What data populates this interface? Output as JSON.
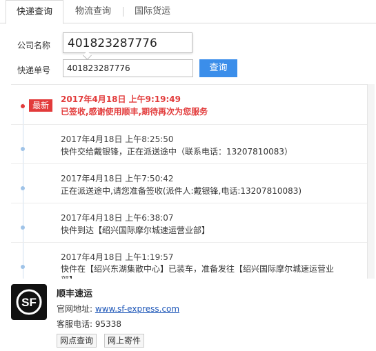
{
  "tabs": [
    {
      "label": "快递查询"
    },
    {
      "label": "物流查询"
    },
    {
      "label": "国际货运"
    }
  ],
  "form": {
    "company_label": "公司名称",
    "number_label": "快递单号",
    "company_value": "",
    "number_value": "401823287776",
    "hint_value": "401823287776",
    "query_button": "查询"
  },
  "result": {
    "latest_badge": "最新",
    "events": [
      {
        "time": "2017年4月18日 上午9:19:49",
        "desc": "已签收,感谢使用顺丰,期待再次为您服务"
      },
      {
        "time": "2017年4月18日 上午8:25:50",
        "desc": "快件交给戴银锋，正在派送途中（联系电话：13207810083）"
      },
      {
        "time": "2017年4月18日 上午7:50:42",
        "desc": "正在派送途中,请您准备签收(派件人:戴银锋,电话:13207810083)"
      },
      {
        "time": "2017年4月18日 上午6:38:07",
        "desc": "快件到达【绍兴国际摩尔城速运营业部】"
      },
      {
        "time": "2017年4月18日 上午1:19:57",
        "desc": "快件在【绍兴东湖集散中心】已装车，准备发往【绍兴国际摩尔城速运营业部】"
      }
    ]
  },
  "company": {
    "name": "顺丰速运",
    "site_label": "官网地址:",
    "site_url": "www.sf-express.com",
    "phone_label": "客服电话:",
    "phone": "95338",
    "btn_outlets": "网点查询",
    "btn_send": "网上寄件",
    "logo_text": "SF"
  },
  "colors": {
    "accent_blue": "#3b8eea",
    "latest_red": "#e23b3b",
    "link_blue": "#1a54b7"
  }
}
